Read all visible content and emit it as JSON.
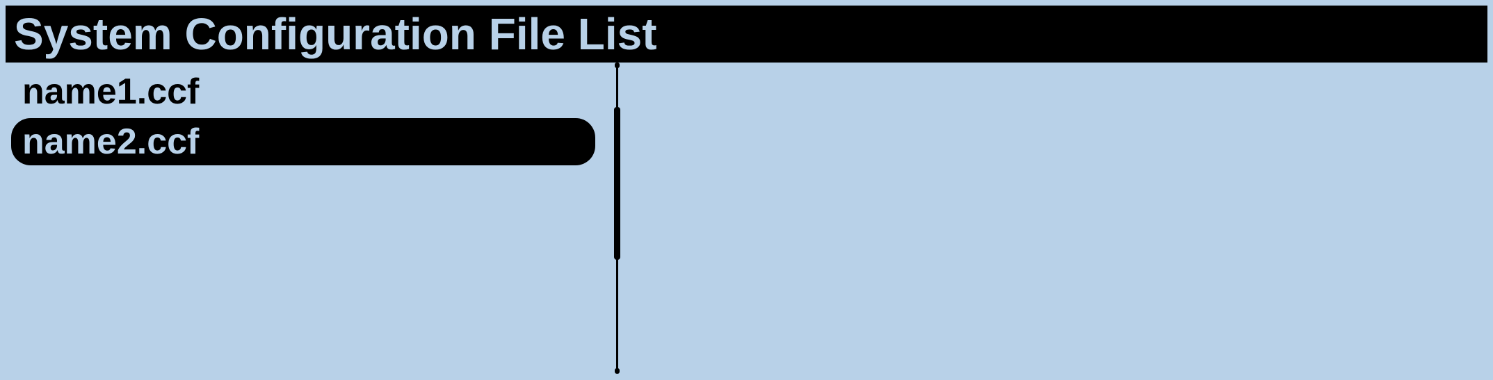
{
  "title": "System Configuration File List",
  "files": [
    {
      "name": "name1.ccf",
      "selected": false
    },
    {
      "name": "name2.ccf",
      "selected": true
    }
  ]
}
